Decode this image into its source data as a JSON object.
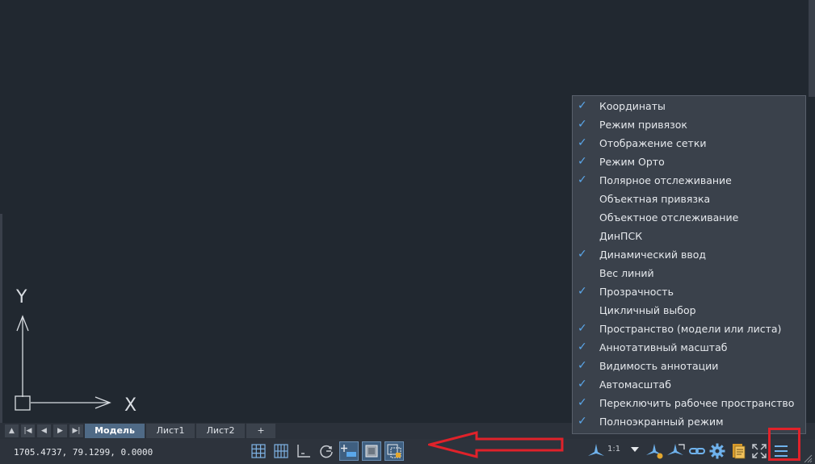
{
  "canvas": {
    "ucs": {
      "y_label": "Y",
      "x_label": "X"
    }
  },
  "layout_tabs": {
    "nav": [
      "▲",
      "|◀",
      "◀",
      "▶",
      "▶|"
    ],
    "tabs": [
      {
        "label": "Модель",
        "active": true
      },
      {
        "label": "Лист1",
        "active": false
      },
      {
        "label": "Лист2",
        "active": false
      },
      {
        "label": "+",
        "active": false
      }
    ]
  },
  "status_bar": {
    "coordinates": "1705.4737, 79.1299, 0.0000",
    "scale": "1:1",
    "buttons": [
      {
        "icon": "grid-icon",
        "on": false
      },
      {
        "icon": "snap-grid-icon",
        "on": false
      },
      {
        "icon": "ortho-icon",
        "on": false
      },
      {
        "icon": "polar-tracking-icon",
        "on": false
      },
      {
        "icon": "dynamic-input-icon",
        "on": true
      },
      {
        "icon": "transparency-icon",
        "on": true
      },
      {
        "icon": "selection-cycling-icon",
        "on": true
      },
      {
        "icon": "annotation-scale-icon",
        "on": false
      },
      {
        "icon": "annotation-visibility-icon",
        "on": false
      },
      {
        "icon": "autoscale-icon",
        "on": false
      },
      {
        "icon": "link-icon",
        "on": false
      },
      {
        "icon": "gear-icon",
        "on": false
      },
      {
        "icon": "document-icon",
        "on": false
      },
      {
        "icon": "fullscreen-icon",
        "on": false
      },
      {
        "icon": "customization-menu-icon",
        "on": false
      }
    ]
  },
  "menu": {
    "items": [
      {
        "label": "Координаты",
        "checked": true
      },
      {
        "label": "Режим привязок",
        "checked": true
      },
      {
        "label": "Отображение сетки",
        "checked": true
      },
      {
        "label": "Режим Орто",
        "checked": true
      },
      {
        "label": "Полярное отслеживание",
        "checked": true
      },
      {
        "label": "Объектная привязка",
        "checked": false
      },
      {
        "label": "Объектное отслеживание",
        "checked": false
      },
      {
        "label": "ДинПСК",
        "checked": false
      },
      {
        "label": "Динамический ввод",
        "checked": true
      },
      {
        "label": "Вес линий",
        "checked": false
      },
      {
        "label": "Прозрачность",
        "checked": true
      },
      {
        "label": "Цикличный выбор",
        "checked": false
      },
      {
        "label": "Пространство (модели или листа)",
        "checked": true
      },
      {
        "label": "Аннотативный масштаб",
        "checked": true
      },
      {
        "label": "Видимость аннотации",
        "checked": true
      },
      {
        "label": "Автомасштаб",
        "checked": true
      },
      {
        "label": "Переключить рабочее пространство",
        "checked": true
      },
      {
        "label": "Полноэкранный режим",
        "checked": true
      }
    ],
    "check_glyph": "✓"
  },
  "colors": {
    "canvas": "#212830",
    "menu_bg": "#3a414b",
    "check": "#5aa7ea",
    "annotation_red": "#e0222a",
    "button_on": "#3f5f80"
  }
}
